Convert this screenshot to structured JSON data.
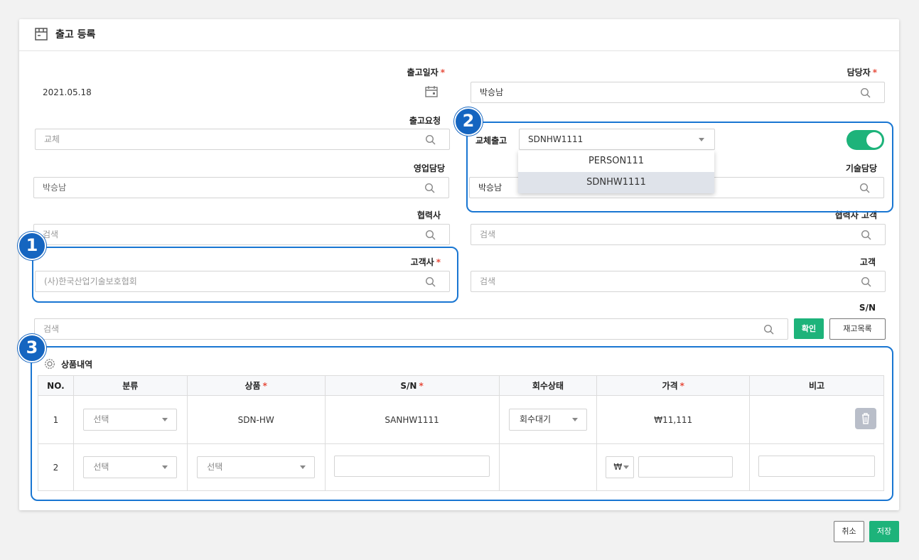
{
  "header": {
    "title": "출고 등록"
  },
  "fields": {
    "ship_date": {
      "label": "출고일자",
      "value": "2021.05.18"
    },
    "manager": {
      "label": "담당자",
      "value": "박승남"
    },
    "ship_request": {
      "label": "출고요청",
      "value": "교체"
    },
    "replace_ship": {
      "label": "교체출고",
      "value": "SDNHW1111"
    },
    "sales_manager": {
      "label": "영업담당",
      "value": "박승남"
    },
    "tech_manager": {
      "label": "기술담당",
      "value": "박승남"
    },
    "partner": {
      "label": "협력사",
      "placeholder": "검색"
    },
    "partner_customer": {
      "label": "협력사 고객",
      "placeholder": "검색"
    },
    "customer_company": {
      "label": "고객사",
      "placeholder": "(사)한국산업기술보호협회"
    },
    "customer": {
      "label": "고객",
      "placeholder": "검색"
    },
    "sn": {
      "label": "S/N",
      "placeholder": "검색"
    }
  },
  "dropdown_options": [
    "PERSON111",
    "SDNHW1111"
  ],
  "toggle_on": true,
  "buttons": {
    "confirm": "확인",
    "stock_list": "재고목록",
    "cancel": "취소",
    "save": "저장"
  },
  "badges": [
    "1",
    "2",
    "3"
  ],
  "products": {
    "section_title": "상품내역",
    "columns": [
      "NO.",
      "분류",
      "상품",
      "S/N",
      "회수상태",
      "가격",
      "비고"
    ],
    "rows": [
      {
        "no": "1",
        "category": "선택",
        "product": "SDN-HW",
        "sn": "SANHW1111",
        "status": "회수대기",
        "price": "₩11,111"
      },
      {
        "no": "2",
        "category": "선택",
        "product": "선택",
        "currency": "₩"
      }
    ]
  },
  "colors": {
    "accent": "#1db37a",
    "highlight": "#1976d2",
    "required": "#e74c3c"
  },
  "icons": [
    "package-icon",
    "calendar-icon",
    "search-icon",
    "gear-icon",
    "trash-icon",
    "chevron-down-icon"
  ]
}
